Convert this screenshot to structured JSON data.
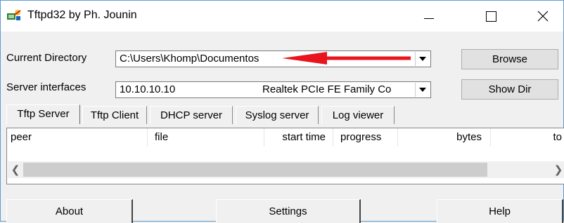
{
  "window": {
    "title": "Tftpd32 by Ph. Jounin",
    "controls": {
      "minimize": "minimize",
      "maximize": "maximize",
      "close": "×"
    }
  },
  "current_directory": {
    "label": "Current Directory",
    "value": "C:\\Users\\Khomp\\Documentos"
  },
  "server_interfaces": {
    "label": "Server interfaces",
    "ip": "10.10.10.10",
    "adapter": "Realtek PCIe FE Family Co"
  },
  "buttons": {
    "browse": "Browse",
    "show_dir": "Show Dir"
  },
  "tabs": [
    "Tftp Server",
    "Tftp Client",
    "DHCP server",
    "Syslog server",
    "Log viewer"
  ],
  "active_tab": "Tftp Server",
  "table": {
    "columns": [
      "peer",
      "file",
      "start time",
      "progress",
      "bytes",
      "to"
    ],
    "rows": []
  },
  "bottom_buttons": {
    "about": "About",
    "settings": "Settings",
    "help": "Help"
  },
  "colors": {
    "annotation_arrow": "#e8141e",
    "window_border": "#5b9bd5"
  }
}
